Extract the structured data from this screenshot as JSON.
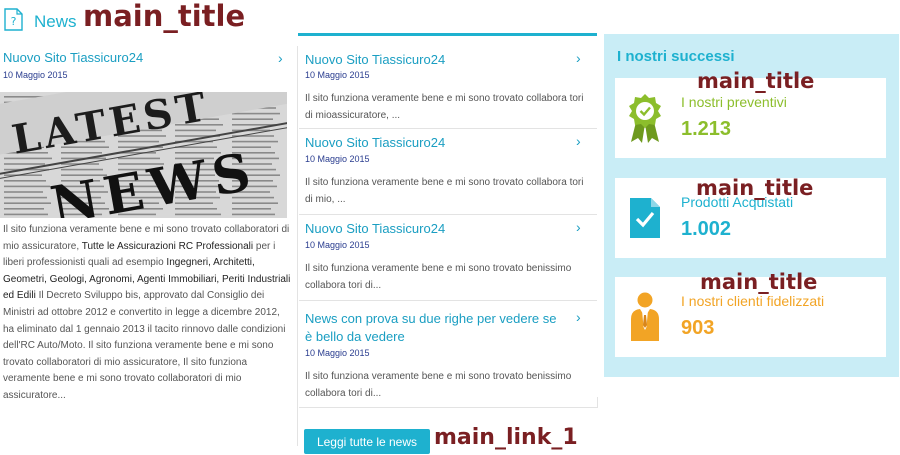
{
  "overlay_labels": {
    "header": "main_title",
    "card_1": "main_title",
    "card_2": "main_title",
    "card_3": "main_title",
    "read_all": "main_link_1"
  },
  "header": {
    "title": "News"
  },
  "lead_article": {
    "title": "Nuovo Sito Tiassicuro24",
    "date": "10 Maggio 2015",
    "image_text": "LATEST NEWS",
    "body": [
      {
        "text": "Il sito funziona veramente bene e mi sono trovato collaboratori di mio assicuratore, "
      },
      {
        "text": "Tutte le Assicurazioni RC Professionali",
        "strong": true
      },
      {
        "text": " per i liberi professionisti quali ad esempio "
      },
      {
        "text": "Ingegneri, Architetti, Geometri, Geologi, Agronomi, Agenti Immobiliari, Periti Industriali ed Edili",
        "strong": true
      },
      {
        "text": " Il Decreto Sviluppo bis, approvato dal Consiglio dei Ministri ad ottobre 2012 e convertito in legge a dicembre 2012, ha eliminato dal 1 gennaio 2013 il tacito rinnovo dalle condizioni dell'RC Auto/Moto. Il sito funziona veramente bene e mi sono trovato collaboratori di mio assicuratore, Il sito funziona veramente bene e mi sono trovato collaboratori di mio assicuratore..."
      }
    ]
  },
  "articles": [
    {
      "title": "Nuovo Sito Tiassicuro24",
      "date": "10 Maggio 2015",
      "excerpt": "Il sito funziona veramente bene e mi sono trovato collabora tori di mioassicuratore, ..."
    },
    {
      "title": "Nuovo Sito Tiassicuro24",
      "date": "10 Maggio 2015",
      "excerpt": "Il sito funziona veramente bene e mi sono trovato collabora tori di mio, ..."
    },
    {
      "title": "Nuovo Sito Tiassicuro24",
      "date": "10 Maggio 2015",
      "excerpt": "Il sito funziona veramente bene e mi sono trovato benissimo collabora tori di..."
    },
    {
      "title": "News con prova su due righe per vedere se è bello da vedere",
      "date": "10 Maggio 2015",
      "excerpt": "Il sito funziona veramente bene e mi sono trovato benissimo collabora tori di..."
    }
  ],
  "read_all": {
    "label": "Leggi tutte le news"
  },
  "success": {
    "title": "I nostri successi",
    "cards": [
      {
        "label": "I nostri preventivi",
        "value": "1.213",
        "color": "#8cbe2c",
        "icon": "award-ribbon-icon"
      },
      {
        "label": "Prodotti Acquistati",
        "value": "1.002",
        "color": "#1eb1cf",
        "icon": "checked-document-icon"
      },
      {
        "label": "I nostri clienti fidelizzati",
        "value": "903",
        "color": "#f2a425",
        "icon": "businessman-icon"
      }
    ]
  },
  "colors": {
    "accent": "#1eb1cf",
    "panel_bg": "#c9edf6",
    "label": "#7a1f22"
  }
}
